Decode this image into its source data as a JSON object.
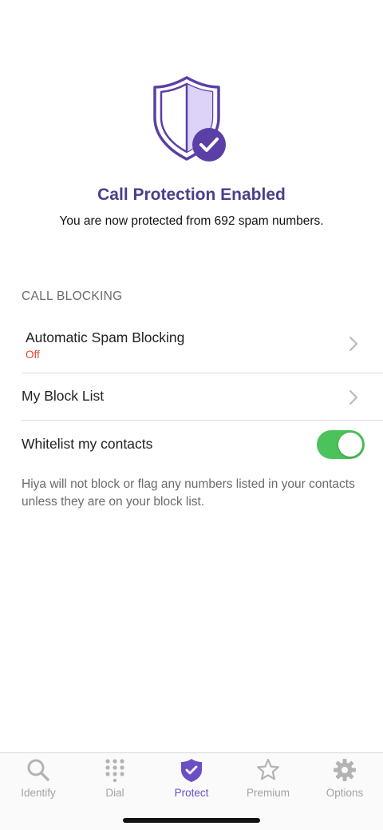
{
  "hero": {
    "title": "Call Protection Enabled",
    "subtitle": "You are now protected from 692 spam numbers.",
    "icon": "shield-check-icon"
  },
  "call_blocking": {
    "header": "CALL BLOCKING",
    "automatic_spam": {
      "label": "Automatic Spam Blocking",
      "status": "Off"
    },
    "block_list": {
      "label": "My Block List"
    },
    "whitelist": {
      "label": "Whitelist my contacts",
      "enabled": true
    },
    "footnote": "Hiya will not block or flag any numbers listed in your contacts unless they are on your block list."
  },
  "tabs": [
    {
      "label": "Identify",
      "icon": "search-icon",
      "active": false
    },
    {
      "label": "Dial",
      "icon": "dialpad-icon",
      "active": false
    },
    {
      "label": "Protect",
      "icon": "shield-check-icon",
      "active": true
    },
    {
      "label": "Premium",
      "icon": "star-icon",
      "active": false
    },
    {
      "label": "Options",
      "icon": "gear-icon",
      "active": false
    }
  ],
  "colors": {
    "brand": "#4a3f8c",
    "accent": "#6a4fc4",
    "toggle_on": "#4cc35a",
    "status_off": "#e5442e"
  }
}
